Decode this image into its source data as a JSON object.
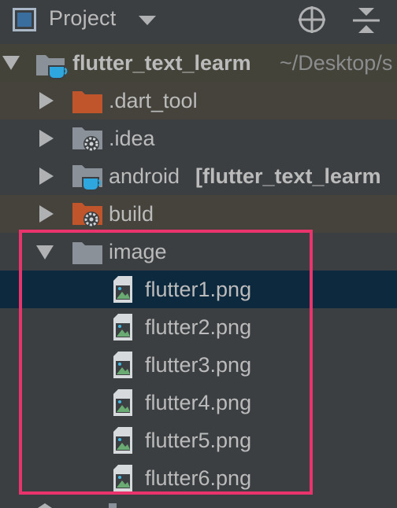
{
  "header": {
    "title": "Project",
    "icons": [
      "project-view-icon",
      "dropdown-caret-icon",
      "locate-target-icon",
      "collapse-all-icon"
    ]
  },
  "tree": {
    "root": {
      "name": "flutter_text_learm",
      "path": "~/Desktop/s",
      "icon": "flutter-module-folder-icon"
    },
    "items": [
      {
        "name": ".dart_tool",
        "icon": "excluded-folder-icon"
      },
      {
        "name": ".idea",
        "icon": "settings-folder-icon"
      },
      {
        "name": "android",
        "module": "[flutter_text_learm",
        "icon": "flutter-module-folder-icon"
      },
      {
        "name": "build",
        "icon": "excluded-settings-folder-icon"
      },
      {
        "name": "image",
        "icon": "folder-icon"
      }
    ],
    "files": [
      "flutter1.png",
      "flutter2.png",
      "flutter3.png",
      "flutter4.png",
      "flutter5.png",
      "flutter6.png"
    ]
  },
  "colors": {
    "background": "#3b3f41",
    "root_row": "#44433a",
    "excluded_row": "#46433c",
    "selected_row": "#0d293e",
    "highlight_box": "#e8336d",
    "text": "#bbbbbb",
    "excluded_folder": "#c0552b",
    "folder": "#8a9199"
  }
}
